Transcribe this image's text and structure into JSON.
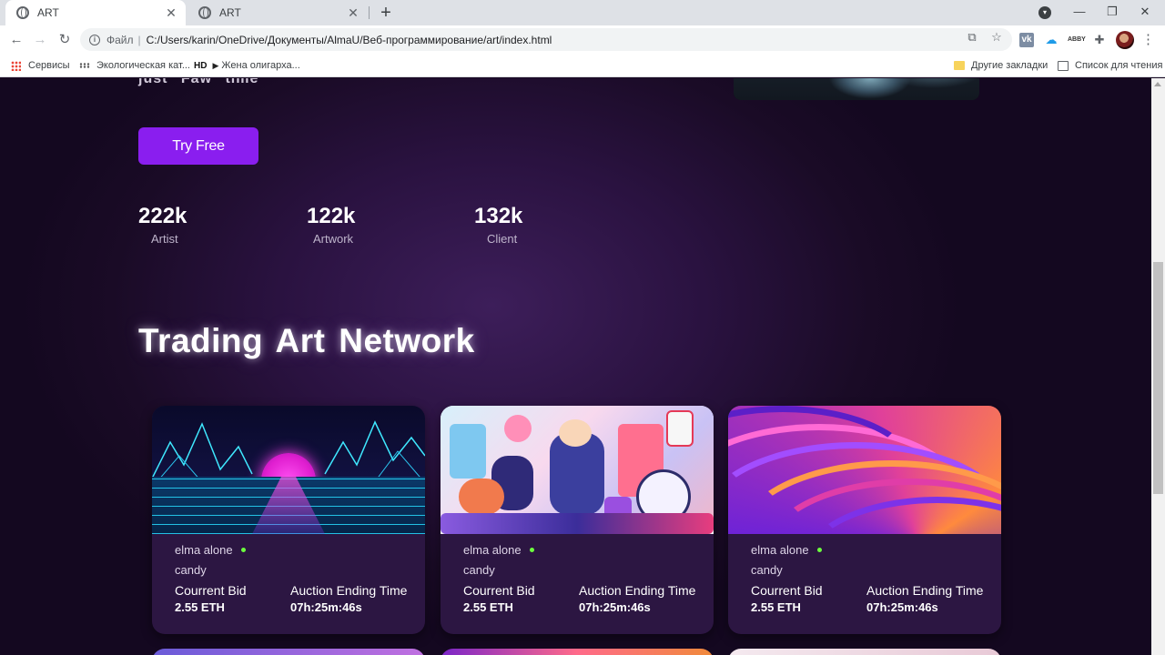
{
  "browser": {
    "tabs": [
      {
        "title": "ART",
        "active": true
      },
      {
        "title": "ART",
        "active": false
      }
    ],
    "new_tab_symbol": "+",
    "window_controls": {
      "minimize": "—",
      "maximize": "❐",
      "close": "✕"
    },
    "address": {
      "scheme": "Файл",
      "url": "C:/Users/karin/OneDrive/Документы/AlmaU/Веб-программирование/art/index.html"
    },
    "extensions": [
      "vk",
      "cloud",
      "abbyy",
      "puzzle"
    ],
    "bookmarks": [
      {
        "label": "Сервисы",
        "icon": "apps-grid-icon"
      },
      {
        "label": "Экологическая кат...",
        "icon": "dots-icon"
      },
      {
        "label": "Жена олигарха...",
        "icon": "hd-icon",
        "prefix": "HD"
      }
    ],
    "bookmarks_right": [
      {
        "label": "Другие закладки",
        "icon": "folder-icon"
      },
      {
        "label": "Список для чтения",
        "icon": "reading-list-icon"
      }
    ]
  },
  "hero": {
    "partial_text": "just  Faw  time",
    "cta_label": "Try Free"
  },
  "stats": [
    {
      "value": "222k",
      "label": "Artist"
    },
    {
      "value": "122k",
      "label": "Artwork"
    },
    {
      "value": "132k",
      "label": "Client"
    }
  ],
  "section": {
    "title": "Trading Art Network"
  },
  "cards": [
    {
      "creator": "elma alone",
      "item": "candy",
      "bid_label": "Courrent Bid",
      "bid_value": "2.55 ETH",
      "time_label": "Auction Ending Time",
      "time_value": "07h:25m:46s",
      "art": "synthwave-grid"
    },
    {
      "creator": "elma alone",
      "item": "candy",
      "bid_label": "Courrent Bid",
      "bid_value": "2.55 ETH",
      "time_label": "Auction Ending Time",
      "time_value": "07h:25m:46s",
      "art": "character-illustration"
    },
    {
      "creator": "elma alone",
      "item": "candy",
      "bid_label": "Courrent Bid",
      "bid_value": "2.55 ETH",
      "time_label": "Auction Ending Time",
      "time_value": "07h:25m:46s",
      "art": "abstract-swirl"
    }
  ],
  "colors": {
    "accent": "#8a1eef",
    "background": "#1a0b24",
    "card": "#2c1642",
    "online": "#6cff3e"
  }
}
